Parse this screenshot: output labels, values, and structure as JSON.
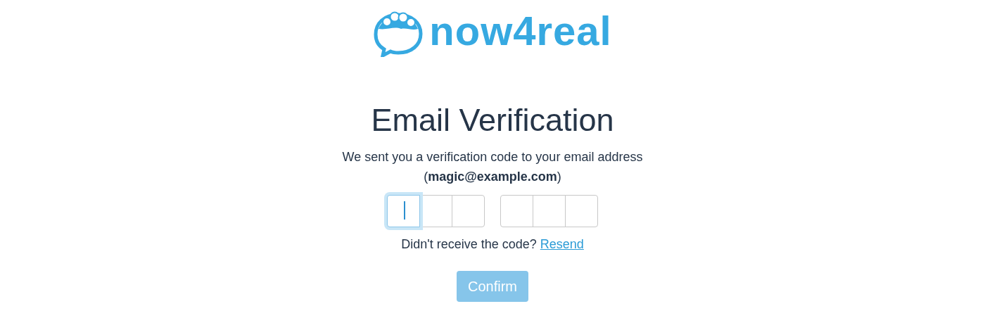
{
  "logo": {
    "text": "now4real"
  },
  "title": "Email Verification",
  "message": "We sent you a verification code to your email address (**magic@example.com**)",
  "code_groups": [
    {
      "fields": [
        {
          "focused": true
        },
        {
          "focused": false
        },
        {
          "focused": false
        }
      ]
    },
    {
      "fields": [
        {
          "focused": false
        },
        {
          "focused": false
        },
        {
          "focused": false
        }
      ]
    }
  ],
  "resend_prompt": {
    "text": "Didn't receive the code?",
    "link": "Resend"
  },
  "confirm_button": {
    "label": "Confirm",
    "disabled": true
  }
}
